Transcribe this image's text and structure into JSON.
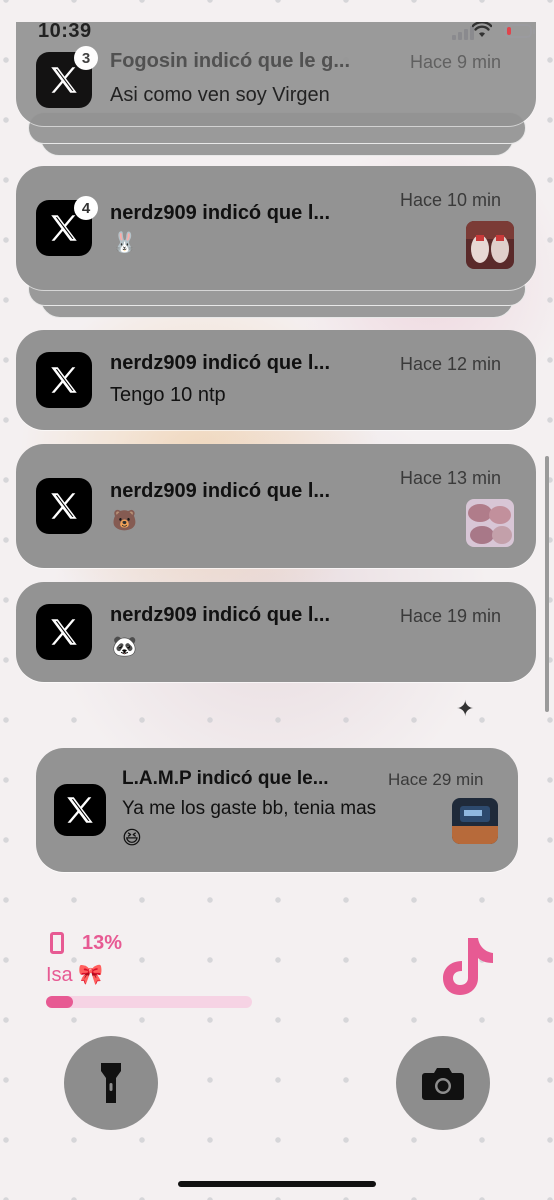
{
  "status_bar": {
    "time": "10:39",
    "battery_level_percent": 13
  },
  "notifications": [
    {
      "app": "x-logo-icon",
      "badge": "3",
      "title": "Fogosin indicó que le g...",
      "time": "Hace 9 min",
      "body": "Asi como ven soy Virgen",
      "thumbnail": false
    },
    {
      "app": "x-logo-icon",
      "badge": "4",
      "title": "nerdz909 indicó que l...",
      "time": "Hace 10 min",
      "body": "🐰",
      "thumbnail": true
    },
    {
      "app": "x-logo-icon",
      "badge": "",
      "title": "nerdz909 indicó que l...",
      "time": "Hace 12 min",
      "body": "Tengo 10 ntp",
      "thumbnail": false
    },
    {
      "app": "x-logo-icon",
      "badge": "",
      "title": "nerdz909 indicó que l...",
      "time": "Hace 13 min",
      "body": "🐻",
      "thumbnail": true
    },
    {
      "app": "x-logo-icon",
      "badge": "",
      "title": "nerdz909 indicó que l...",
      "time": "Hace 19 min",
      "body": "🐼",
      "thumbnail": false
    },
    {
      "app": "x-logo-icon",
      "badge": "",
      "title": "L.A.M.P indicó que le...",
      "time": "Hace 29 min",
      "body_line1": "Ya me los gaste bb, tenia mas",
      "body_line2": "😆",
      "thumbnail": true
    }
  ],
  "battery_widget": {
    "percent_label": "13%",
    "name": "Isa 🎀",
    "level_fraction": 0.13
  },
  "lock_actions": {
    "left": "flashlight-icon",
    "right": "camera-icon"
  },
  "colors": {
    "accent_pink": "#e75a93",
    "card_gray": "#939393"
  }
}
